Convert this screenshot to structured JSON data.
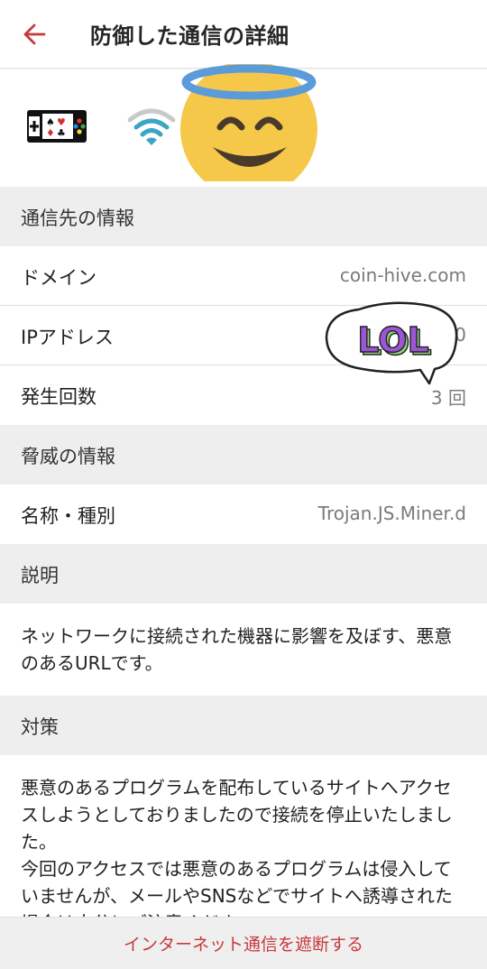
{
  "header": {
    "title": "防御した通信の詳細",
    "back_icon": "arrow-left-icon"
  },
  "icons": [
    "gamepad-cards-icon",
    "wifi-icon",
    "smiling-face-with-halo-emoji"
  ],
  "sticker": {
    "text": "LOL"
  },
  "sections": {
    "destination": "通信先の情報",
    "threat": "脅威の情報",
    "description": "説明",
    "countermeasure": "対策"
  },
  "rows": {
    "domain": {
      "label": "ドメイン",
      "value": "coin-hive.com"
    },
    "ip": {
      "label": "IPアドレス",
      "value": "0"
    },
    "count": {
      "label": "発生回数",
      "value": "3 回"
    },
    "name": {
      "label": "名称・種別",
      "value": "Trojan.JS.Miner.d"
    }
  },
  "description_text": "ネットワークに接続された機器に影響を及ぼす、悪意のあるURLです。",
  "countermeasure_text": "悪意のあるプログラムを配布しているサイトへアクセスしようとしておりましたので接続を停止いたしました。\n今回のアクセスでは悪意のあるプログラムは侵入していませんが、メールやSNSなどでサイトへ誘導された場合は十分にご注意ください。",
  "bottom_action": "インターネット通信を遮断する",
  "colors": {
    "accent": "#c8393c",
    "section_bg": "#eeeeee",
    "value_gray": "#7a7a7a",
    "wifi": "#3aa6c4"
  }
}
